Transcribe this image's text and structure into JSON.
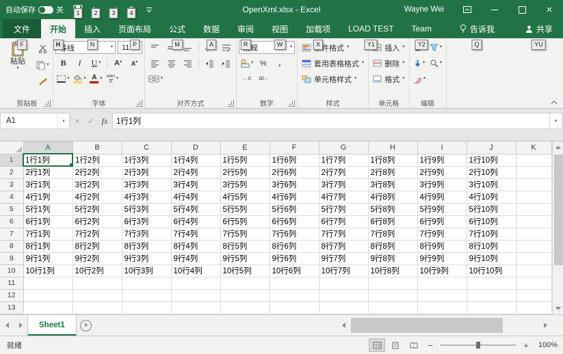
{
  "titlebar": {
    "autosave_label": "自动保存",
    "autosave_state": "关",
    "qat": [
      {
        "name": "save",
        "keytip": "1"
      },
      {
        "name": "undo",
        "keytip": "2"
      },
      {
        "name": "redo",
        "keytip": "3"
      },
      {
        "name": "touch-mode",
        "keytip": "4"
      }
    ],
    "title": "OpenXml.xlsx - Excel",
    "user": "Wayne Wei"
  },
  "ribbon": {
    "file_tab": {
      "label": "文件",
      "keytip": "F"
    },
    "tabs": [
      {
        "label": "开始",
        "keytip": "H",
        "active": true
      },
      {
        "label": "插入",
        "keytip": "N"
      },
      {
        "label": "页面布局",
        "keytip": "P"
      },
      {
        "label": "公式",
        "keytip": "M"
      },
      {
        "label": "数据",
        "keytip": "A"
      },
      {
        "label": "审阅",
        "keytip": "R"
      },
      {
        "label": "视图",
        "keytip": "W"
      },
      {
        "label": "加载项",
        "keytip": "X"
      },
      {
        "label": "LOAD TEST",
        "keytip": "Y1"
      },
      {
        "label": "Team",
        "keytip": "Y2"
      }
    ],
    "tell_me": {
      "label": "告诉我",
      "keytip": "Q"
    },
    "share": {
      "label": "共享",
      "keytip": "YU"
    },
    "groups": {
      "clipboard": {
        "label": "剪贴板",
        "paste_label": "粘贴"
      },
      "font": {
        "label": "字体",
        "font_name": "等线",
        "font_size": "11",
        "bold": "B",
        "italic": "I",
        "underline": "U",
        "phonetic_top": "wén",
        "phonetic_bottom": "文"
      },
      "alignment": {
        "label": "对齐方式",
        "orientation_glyph": "ab"
      },
      "number": {
        "label": "数字",
        "format": "常规",
        "percent": "%",
        "comma": ",",
        "increase_decimal": "←.0",
        "decrease_decimal": ".00→"
      },
      "styles": {
        "label": "样式",
        "conditional": "条件格式",
        "format_table": "套用表格格式",
        "cell_styles": "单元格样式"
      },
      "cells": {
        "label": "单元格",
        "insert": "插入",
        "delete": "删除",
        "format": "格式"
      },
      "editing": {
        "label": "编辑",
        "autosum_glyph": "Σ"
      }
    }
  },
  "formula_bar": {
    "name_box": "A1",
    "fx": "fx",
    "value": "1行1列"
  },
  "grid": {
    "columns": [
      "A",
      "B",
      "C",
      "D",
      "E",
      "F",
      "G",
      "H",
      "I",
      "J",
      "K"
    ],
    "visible_rows": 13,
    "selected_cell": "A1",
    "data": [
      [
        "1行1列",
        "1行2列",
        "1行3列",
        "1行4列",
        "1行5列",
        "1行6列",
        "1行7列",
        "1行8列",
        "1行9列",
        "1行10列"
      ],
      [
        "2行1列",
        "2行2列",
        "2行3列",
        "2行4列",
        "2行5列",
        "2行6列",
        "2行7列",
        "2行8列",
        "2行9列",
        "2行10列"
      ],
      [
        "3行1列",
        "3行2列",
        "3行3列",
        "3行4列",
        "3行5列",
        "3行6列",
        "3行7列",
        "3行8列",
        "3行9列",
        "3行10列"
      ],
      [
        "4行1列",
        "4行2列",
        "4行3列",
        "4行4列",
        "4行5列",
        "4行6列",
        "4行7列",
        "4行8列",
        "4行9列",
        "4行10列"
      ],
      [
        "5行1列",
        "5行2列",
        "5行3列",
        "5行4列",
        "5行5列",
        "5行6列",
        "5行7列",
        "5行8列",
        "5行9列",
        "5行10列"
      ],
      [
        "6行1列",
        "6行2列",
        "6行3列",
        "6行4列",
        "6行5列",
        "6行6列",
        "6行7列",
        "6行8列",
        "6行9列",
        "6行10列"
      ],
      [
        "7行1列",
        "7行2列",
        "7行3列",
        "7行4列",
        "7行5列",
        "7行6列",
        "7行7列",
        "7行8列",
        "7行9列",
        "7行10列"
      ],
      [
        "8行1列",
        "8行2列",
        "8行3列",
        "8行4列",
        "8行5列",
        "8行6列",
        "8行7列",
        "8行8列",
        "8行9列",
        "8行10列"
      ],
      [
        "9行1列",
        "9行2列",
        "9行3列",
        "9行4列",
        "9行5列",
        "9行6列",
        "9行7列",
        "9行8列",
        "9行9列",
        "9行10列"
      ],
      [
        "10行1列",
        "10行2列",
        "10行3列",
        "10行4列",
        "10行5列",
        "10行6列",
        "10行7列",
        "10行8列",
        "10行9列",
        "10行10列"
      ]
    ]
  },
  "sheet_bar": {
    "active_sheet": "Sheet1",
    "add_label": "+"
  },
  "status_bar": {
    "mode": "就绪",
    "zoom_level": "100%"
  }
}
